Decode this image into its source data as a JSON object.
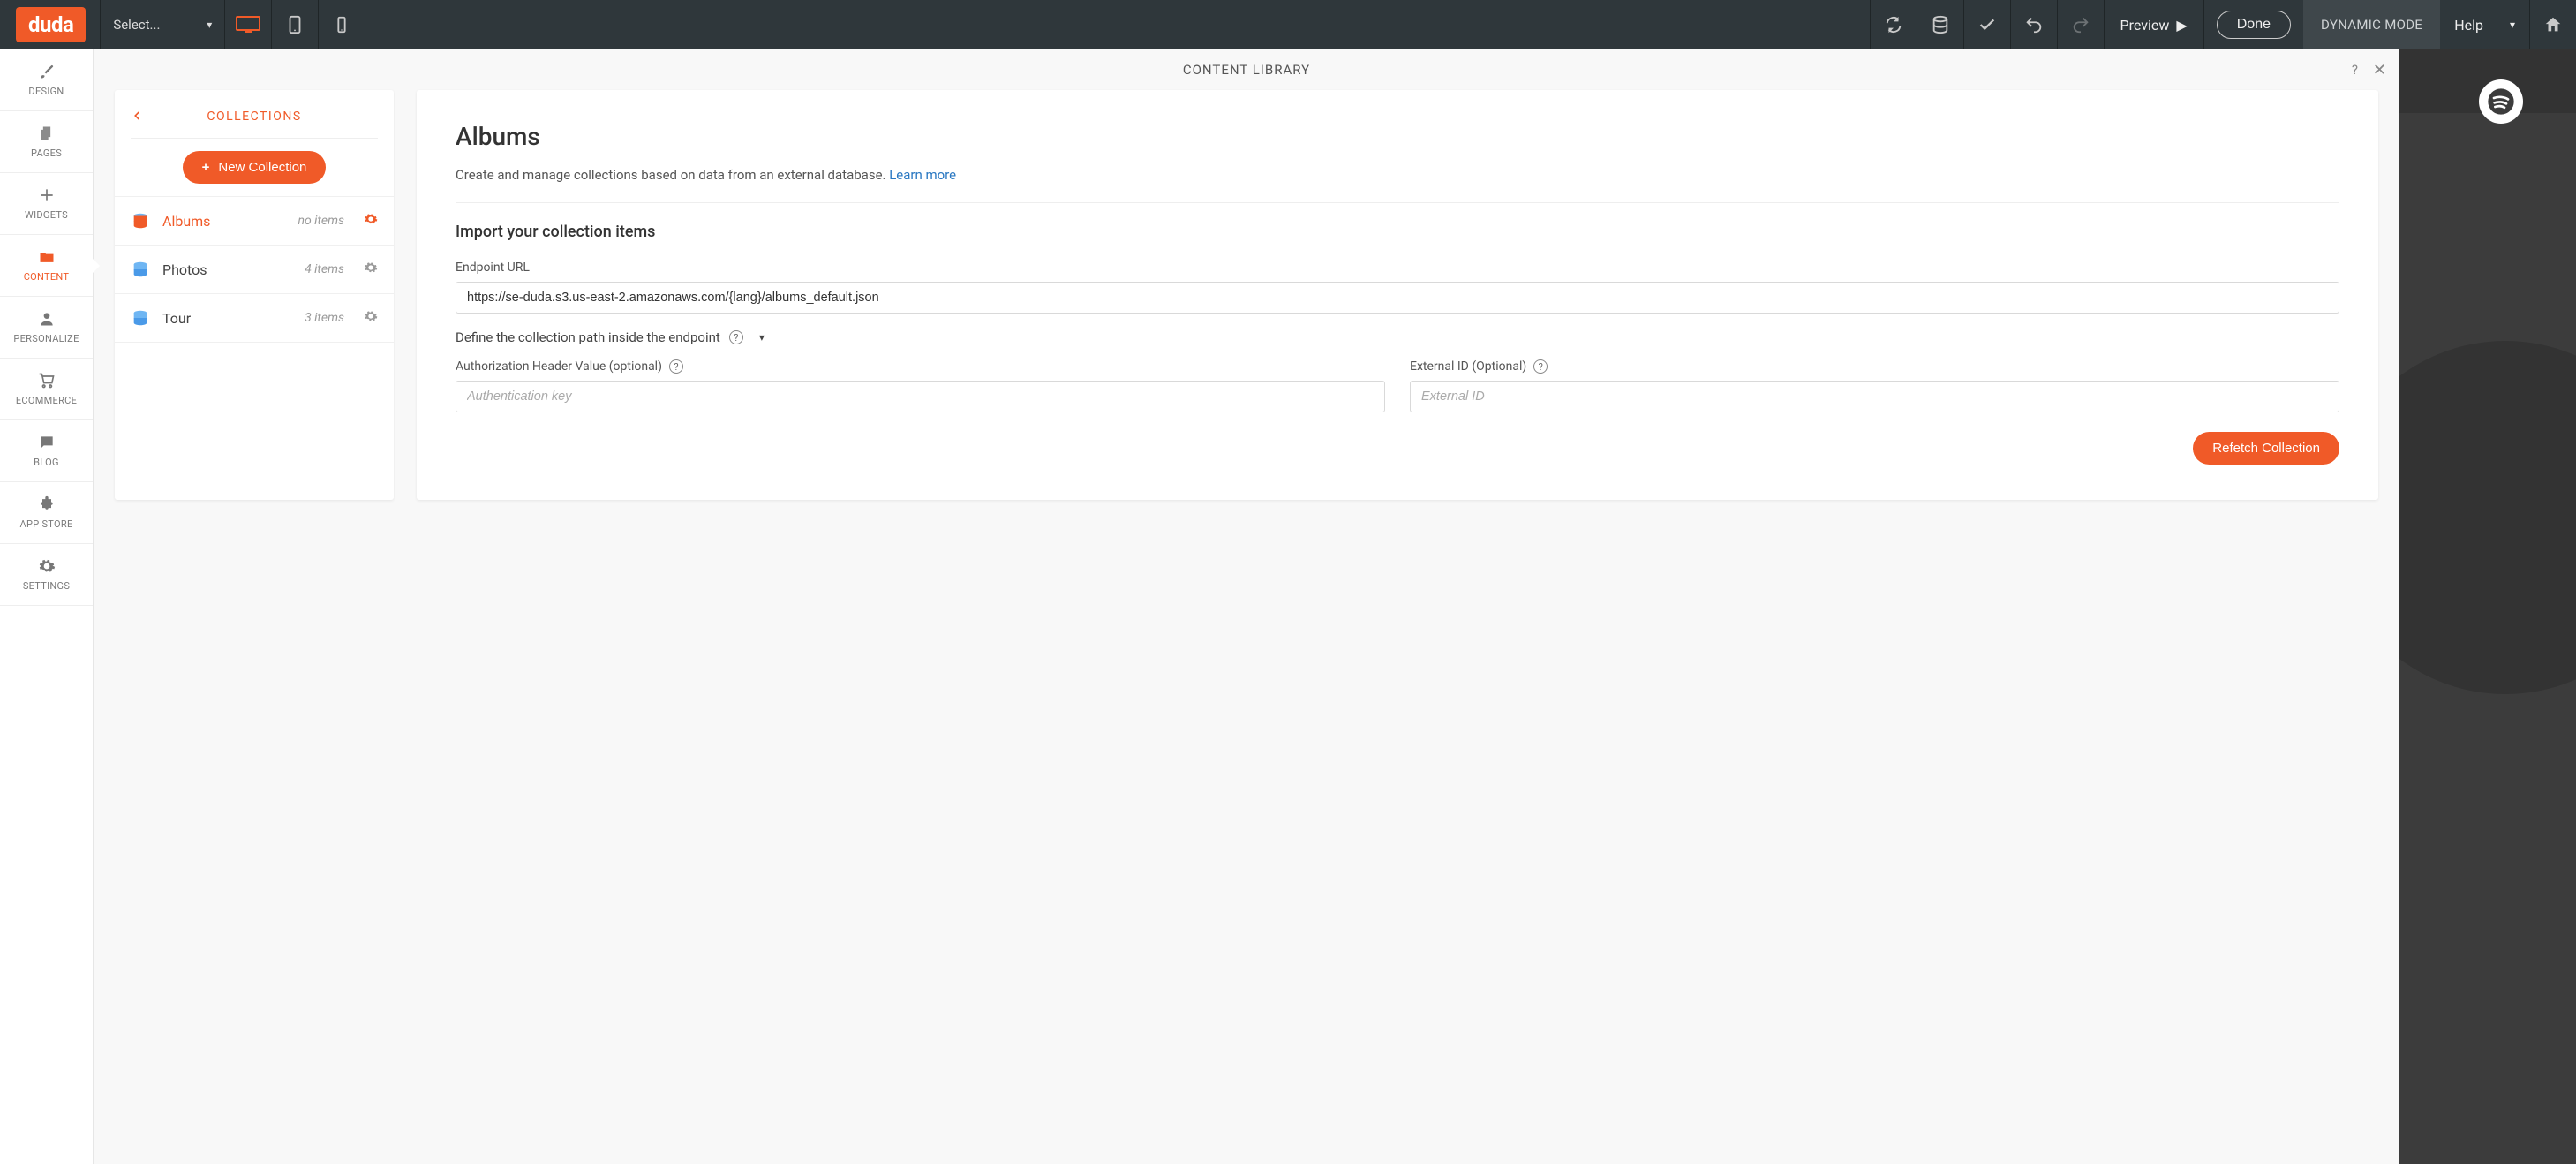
{
  "brand": "duda",
  "topbar": {
    "select_placeholder": "Select...",
    "preview_label": "Preview",
    "done_label": "Done",
    "dynamic_mode_label": "DYNAMIC MODE",
    "help_label": "Help"
  },
  "left_rail": [
    {
      "id": "design",
      "label": "DESIGN",
      "icon": "brush"
    },
    {
      "id": "pages",
      "label": "PAGES",
      "icon": "pages"
    },
    {
      "id": "widgets",
      "label": "WIDGETS",
      "icon": "plus"
    },
    {
      "id": "content",
      "label": "CONTENT",
      "icon": "folder",
      "active": true
    },
    {
      "id": "personalize",
      "label": "PERSONALIZE",
      "icon": "person"
    },
    {
      "id": "ecommerce",
      "label": "ECOMMERCE",
      "icon": "cart"
    },
    {
      "id": "blog",
      "label": "BLOG",
      "icon": "chat"
    },
    {
      "id": "appstore",
      "label": "APP STORE",
      "icon": "puzzle"
    },
    {
      "id": "settings",
      "label": "SETTINGS",
      "icon": "gear"
    }
  ],
  "content_library": {
    "title": "CONTENT LIBRARY",
    "collections_title": "COLLECTIONS",
    "new_collection_label": "New Collection",
    "collections": [
      {
        "name": "Albums",
        "meta": "no items",
        "active": true
      },
      {
        "name": "Photos",
        "meta": "4 items"
      },
      {
        "name": "Tour",
        "meta": "3 items"
      }
    ],
    "detail": {
      "title": "Albums",
      "subtitle_pre": "Create and manage collections based on data from an external database. ",
      "learn_more": "Learn more",
      "import_heading": "Import your collection items",
      "endpoint_label": "Endpoint URL",
      "endpoint_value": "https://se-duda.s3.us-east-2.amazonaws.com/{lang}/albums_default.json",
      "path_label": "Define the collection path inside the endpoint",
      "auth_label": "Authorization Header Value (optional)",
      "auth_placeholder": "Authentication key",
      "extid_label": "External ID (Optional)",
      "extid_placeholder": "External ID",
      "refetch_label": "Refetch Collection"
    }
  }
}
